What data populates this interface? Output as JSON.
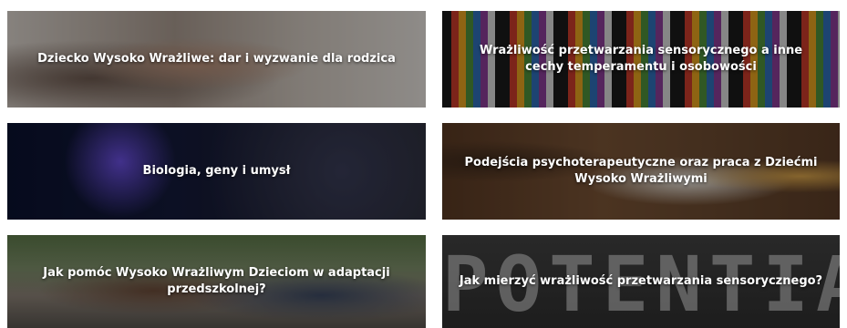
{
  "cards": [
    {
      "title": "Dziecko Wysoko Wrażliwe: dar i wyzwanie dla rodzica"
    },
    {
      "title": "Wrażliwość przetwarzania sensorycznego a inne cechy temperamentu i osobowości"
    },
    {
      "title": "Biologia, geny i umysł"
    },
    {
      "title": "Podejścia psychoterapeutyczne oraz praca z Dziećmi Wysoko Wrażliwymi"
    },
    {
      "title": "Jak pomóc Wysoko Wrażliwym Dzieciom w adaptacji przedszkolnej?"
    },
    {
      "title": "Jak mierzyć wrażliwość przetwarzania sensorycznego?",
      "background_word": "POTENTIAL"
    }
  ]
}
